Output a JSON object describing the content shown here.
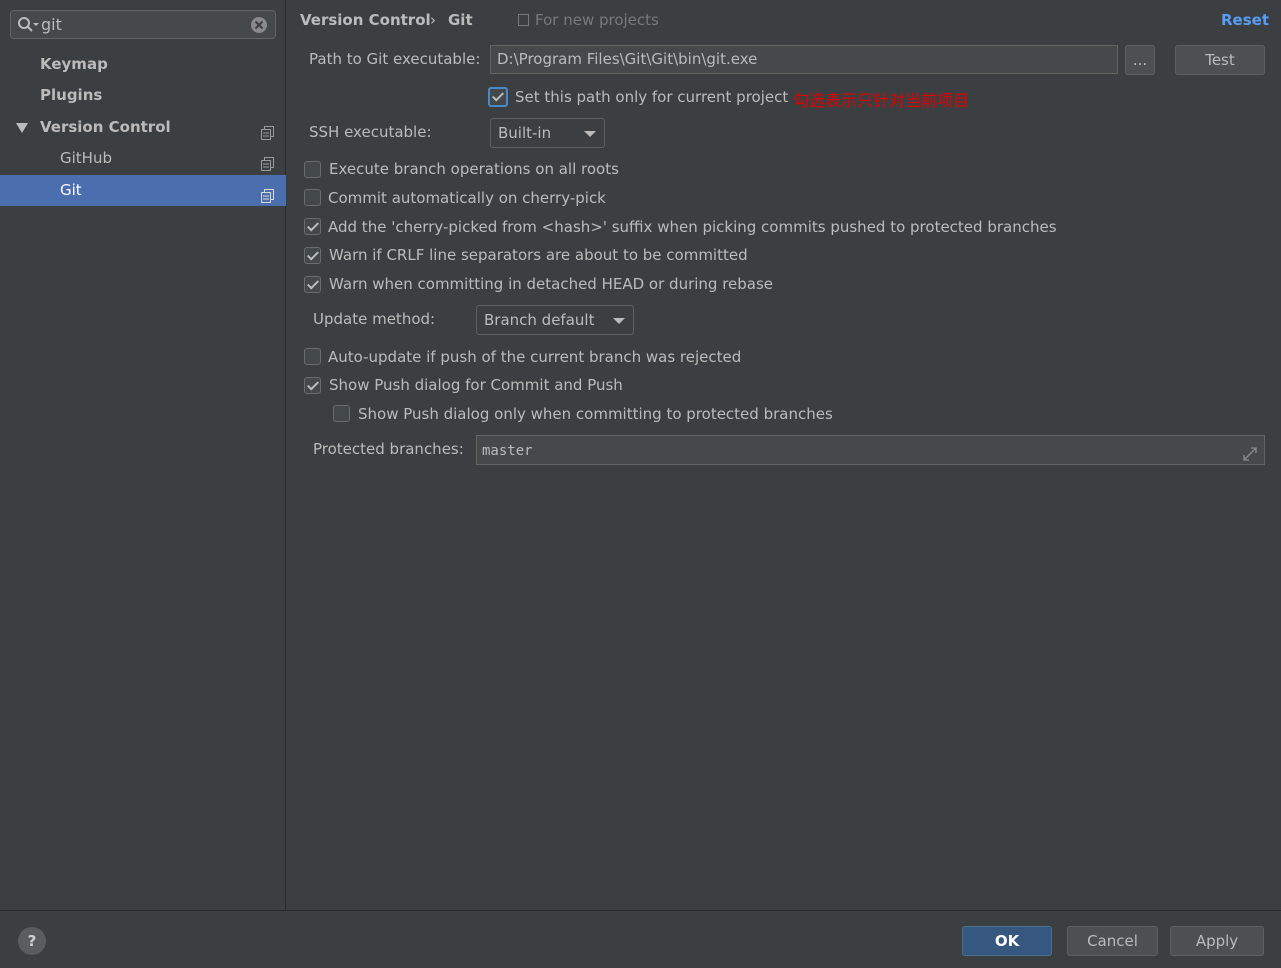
{
  "search": {
    "value": "git"
  },
  "sidebar": {
    "items": [
      {
        "label": "Keymap"
      },
      {
        "label": "Plugins"
      },
      {
        "label": "Version Control"
      },
      {
        "label": "GitHub"
      },
      {
        "label": "Git"
      }
    ]
  },
  "header": {
    "crumb_parent": "Version Control",
    "crumb_separator": "›",
    "crumb_current": "Git",
    "scope": "For new projects",
    "reset": "Reset"
  },
  "git": {
    "path_label": "Path to Git executable:",
    "path_value": "D:\\Program Files\\Git\\Git\\bin\\git.exe",
    "browse": "...",
    "test": "Test",
    "project_only_label": "Set this path only for current project",
    "project_only_checked": true,
    "annotation": "勾选表示只针对当前项目",
    "ssh_label": "SSH executable:",
    "ssh_value": "Built-in",
    "options": [
      {
        "label": "Execute branch operations on all roots",
        "checked": false
      },
      {
        "label": "Commit automatically on cherry-pick",
        "checked": false
      },
      {
        "label": "Add the 'cherry-picked from <hash>' suffix when picking commits pushed to protected branches",
        "checked": true
      },
      {
        "label": "Warn if CRLF line separators are about to be committed",
        "checked": true
      },
      {
        "label": "Warn when committing in detached HEAD or during rebase",
        "checked": true
      }
    ],
    "update_label": "Update method:",
    "update_value": "Branch default",
    "options2": [
      {
        "label": "Auto-update if push of the current branch was rejected",
        "checked": false
      },
      {
        "label": "Show Push dialog for Commit and Push",
        "checked": true
      },
      {
        "label": "Show Push dialog only when committing to protected branches",
        "checked": false
      }
    ],
    "protected_label": "Protected branches:",
    "protected_value": "master"
  },
  "footer": {
    "help": "?",
    "ok": "OK",
    "cancel": "Cancel",
    "apply": "Apply"
  },
  "colors": {
    "background": "#3c3f41",
    "selection": "#4b6eaf",
    "link": "#589df6",
    "annotation": "#e00000"
  }
}
